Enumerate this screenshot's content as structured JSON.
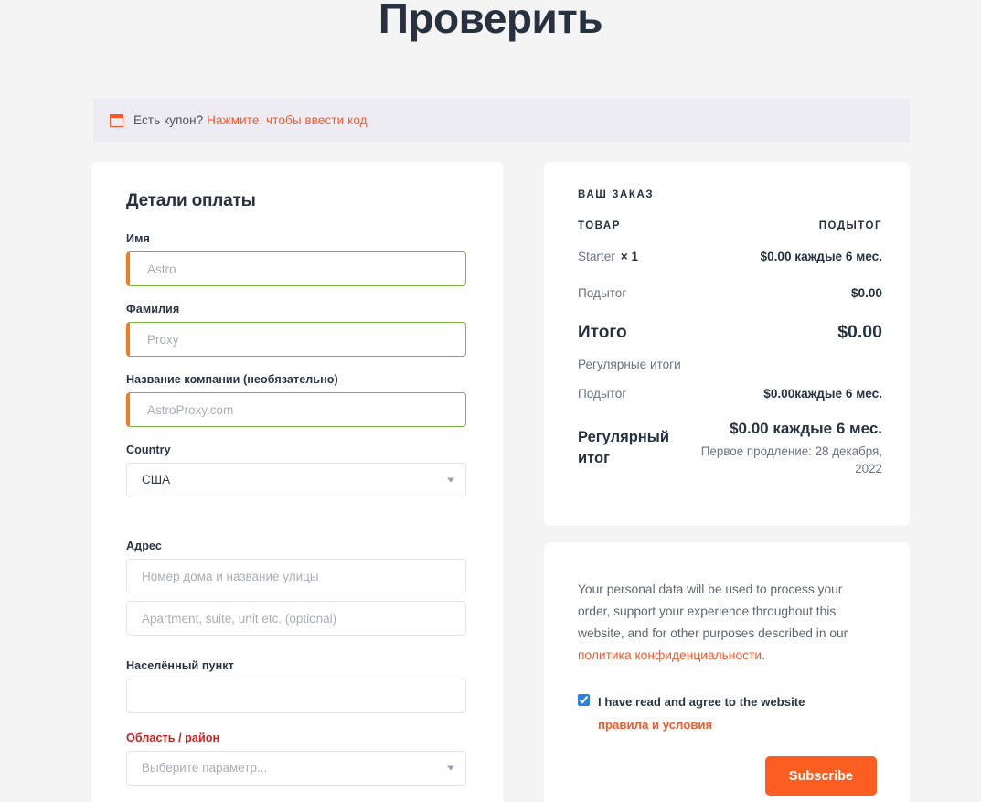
{
  "page": {
    "title": "Проверить",
    "background_color": "#f4f4f5"
  },
  "coupon": {
    "icon": "coupon-ticket-icon",
    "prompt": "Есть купон?",
    "link": "Нажмите, чтобы ввести код",
    "link_color": "#f9572a",
    "bar_color": "#edecf2"
  },
  "billing": {
    "title": "Детали оплаты",
    "fields": [
      {
        "label": "Имя",
        "placeholder": "Astro",
        "value": "",
        "state": "validated",
        "type": "text"
      },
      {
        "label": "Фамилия",
        "placeholder": "Proxy",
        "value": "",
        "state": "validated",
        "type": "text"
      },
      {
        "label": "Название компании (необязательно)",
        "placeholder": "AstroProxy.com",
        "value": "",
        "state": "validated",
        "type": "text"
      },
      {
        "label": "Country",
        "placeholder": "",
        "value": "США",
        "state": "normal",
        "type": "select"
      },
      {
        "label": "Адрес",
        "placeholder": "Номер дома и название улицы",
        "value": "",
        "state": "normal",
        "type": "text"
      },
      {
        "label": "",
        "placeholder": "Apartment, suite, unit etc. (optional)",
        "value": "",
        "state": "normal",
        "type": "text"
      },
      {
        "label": "Населённый пункт",
        "placeholder": "",
        "value": "",
        "state": "normal",
        "type": "text"
      },
      {
        "label": "Область / район",
        "placeholder": "Выберите параметр...",
        "value": "",
        "state": "error",
        "type": "select"
      }
    ],
    "validated_border_color": "#7cb342",
    "validated_accent_color": "#f4791f",
    "error_label_color": "#cf2020"
  },
  "order": {
    "heading": "ВАШ ЗАКАЗ",
    "col_product": "ТОВАР",
    "col_subtotal": "ПОДЫТОГ",
    "line_item": {
      "name": "Starter",
      "quantity": "× 1",
      "price": "$0.00 каждые 6 мес."
    },
    "subtotal_label": "Подытог",
    "subtotal_value": "$0.00",
    "total_label": "Итого",
    "total_value": "$0.00",
    "recurring_totals_label": "Регулярные итоги",
    "recurring_subtotal_label": "Подытог",
    "recurring_subtotal_value": "$0.00каждые 6 мес.",
    "recurring_total_label": "Регулярный итог",
    "recurring_total_amount": "$0.00 каждые 6 мес.",
    "recurring_first_renewal": "Первое продление: 28 декабря, 2022"
  },
  "privacy": {
    "text": "Your personal data will be used to process your order, support your experience throughout this website, and for other purposes described in our ",
    "link": "политика конфиденциальности",
    "period": ".",
    "terms_checked": true,
    "terms_text": "I have read and agree to the website",
    "terms_link": "правила и условия",
    "submit_label": "Subscribe",
    "submit_color": "#fb5e20",
    "link_color": "#f9572a"
  }
}
